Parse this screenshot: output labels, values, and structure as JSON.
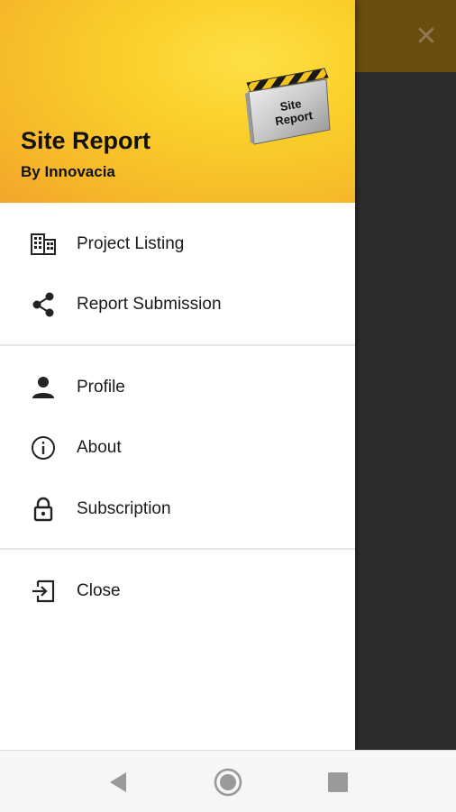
{
  "background": {
    "close_glyph": "✕"
  },
  "header": {
    "title": "Site Report",
    "subtitle": "By Innovacia",
    "logo": {
      "line1": "Site",
      "line2": "Report"
    }
  },
  "menu": {
    "group1": [
      {
        "label": "Project Listing",
        "icon": "building-icon"
      },
      {
        "label": "Report Submission",
        "icon": "share-icon"
      }
    ],
    "group2": [
      {
        "label": "Profile",
        "icon": "person-icon"
      },
      {
        "label": "About",
        "icon": "info-icon"
      },
      {
        "label": "Subscription",
        "icon": "lock-icon"
      }
    ],
    "group3": [
      {
        "label": "Close",
        "icon": "exit-icon"
      }
    ]
  },
  "colors": {
    "header_yellow": "#fbd02a",
    "header_orange": "#f2a52a",
    "scrim": "#2c2c2c"
  },
  "navbar": {
    "buttons": [
      "back-icon",
      "home-icon",
      "recents-icon"
    ]
  }
}
